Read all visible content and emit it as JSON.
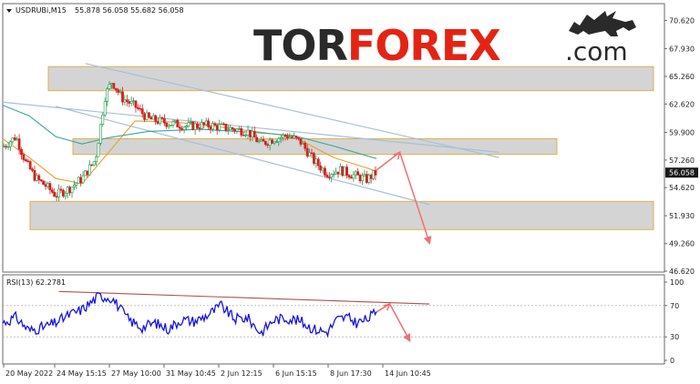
{
  "chart_data": [
    {
      "type": "candlestick",
      "symbol_label": "USDRUBi,M15",
      "ohlc_label": "55.878 56.058 55.682 56.058",
      "current_price": 56.058,
      "current_price_label": "56.058",
      "y_ticks": [
        "70.620",
        "67.930",
        "65.260",
        "62.620",
        "59.900",
        "57.260",
        "54.620",
        "51.930",
        "49.260",
        "46.620"
      ],
      "ylim": [
        46.62,
        70.62
      ],
      "x_ticks": [
        "20 May 2022",
        "24 May 15:15",
        "27 May 10:00",
        "31 May 10:45",
        "2 Jun 12:15",
        "6 Jun 15:15",
        "8 Jun 17:30",
        "14 Jun 10:45"
      ],
      "zones": [
        {
          "from": 63.9,
          "to": 66.2
        },
        {
          "from": 57.8,
          "to": 59.3
        },
        {
          "from": 50.6,
          "to": 53.3
        }
      ],
      "channel": {
        "upper": [
          {
            "t": 0.125,
            "p": 66.5
          },
          {
            "t": 0.75,
            "p": 57.5
          }
        ],
        "middle": [
          {
            "t": 0.0,
            "p": 62.8
          },
          {
            "t": 0.75,
            "p": 58.0
          }
        ],
        "lower": [
          {
            "t": 0.08,
            "p": 62.4
          },
          {
            "t": 0.645,
            "p": 53.0
          }
        ]
      },
      "forecast": [
        {
          "t": 0.565,
          "p": 56.3
        },
        {
          "t": 0.6,
          "p": 58.0
        },
        {
          "t": 0.645,
          "p": 49.3
        }
      ],
      "price_path": [
        {
          "t": 0.0,
          "p": 58.5
        },
        {
          "t": 0.02,
          "p": 59.5
        },
        {
          "t": 0.035,
          "p": 57.0
        },
        {
          "t": 0.05,
          "p": 55.5
        },
        {
          "t": 0.065,
          "p": 54.8
        },
        {
          "t": 0.08,
          "p": 53.9
        },
        {
          "t": 0.1,
          "p": 54.5
        },
        {
          "t": 0.12,
          "p": 55.5
        },
        {
          "t": 0.14,
          "p": 57.3
        },
        {
          "t": 0.155,
          "p": 63.5
        },
        {
          "t": 0.165,
          "p": 64.8
        },
        {
          "t": 0.18,
          "p": 63.2
        },
        {
          "t": 0.2,
          "p": 62.4
        },
        {
          "t": 0.22,
          "p": 61.2
        },
        {
          "t": 0.25,
          "p": 60.8
        },
        {
          "t": 0.28,
          "p": 60.5
        },
        {
          "t": 0.31,
          "p": 60.6
        },
        {
          "t": 0.34,
          "p": 60.3
        },
        {
          "t": 0.37,
          "p": 60.0
        },
        {
          "t": 0.39,
          "p": 58.8
        },
        {
          "t": 0.41,
          "p": 59.3
        },
        {
          "t": 0.43,
          "p": 59.6
        },
        {
          "t": 0.45,
          "p": 59.0
        },
        {
          "t": 0.47,
          "p": 57.2
        },
        {
          "t": 0.49,
          "p": 56.0
        },
        {
          "t": 0.51,
          "p": 56.3
        },
        {
          "t": 0.53,
          "p": 55.8
        },
        {
          "t": 0.55,
          "p": 55.4
        },
        {
          "t": 0.565,
          "p": 56.058
        }
      ],
      "moving_averages": [
        {
          "color": "#e8a030",
          "points": [
            {
              "t": 0.0,
              "p": 59.3
            },
            {
              "t": 0.04,
              "p": 57.5
            },
            {
              "t": 0.08,
              "p": 55.5
            },
            {
              "t": 0.12,
              "p": 55.0
            },
            {
              "t": 0.16,
              "p": 58.0
            },
            {
              "t": 0.2,
              "p": 61.0
            },
            {
              "t": 0.26,
              "p": 60.9
            },
            {
              "t": 0.32,
              "p": 60.5
            },
            {
              "t": 0.38,
              "p": 60.0
            },
            {
              "t": 0.44,
              "p": 59.5
            },
            {
              "t": 0.5,
              "p": 57.5
            },
            {
              "t": 0.565,
              "p": 56.2
            }
          ]
        },
        {
          "color": "#3aa69a",
          "points": [
            {
              "t": 0.0,
              "p": 62.5
            },
            {
              "t": 0.04,
              "p": 61.5
            },
            {
              "t": 0.08,
              "p": 59.5
            },
            {
              "t": 0.12,
              "p": 58.8
            },
            {
              "t": 0.16,
              "p": 59.4
            },
            {
              "t": 0.22,
              "p": 60.0
            },
            {
              "t": 0.3,
              "p": 60.2
            },
            {
              "t": 0.38,
              "p": 59.9
            },
            {
              "t": 0.44,
              "p": 59.6
            },
            {
              "t": 0.5,
              "p": 58.6
            },
            {
              "t": 0.565,
              "p": 57.4
            }
          ]
        }
      ],
      "colors": {
        "bull": "#1a9c4a",
        "bear": "#d62020",
        "zone_fill": "#d4d4d4",
        "zone_border": "#e0b050",
        "channel": "#a8c0d8",
        "forecast": "#f07070",
        "rsi": "#1414e6",
        "rsi_trend": "#b05050"
      }
    },
    {
      "type": "line",
      "indicator_label": "RSI(13) 62.2781",
      "y_ticks": [
        "100",
        "70",
        "30",
        "0"
      ],
      "ylim": [
        0,
        100
      ],
      "levels": [
        70,
        30
      ],
      "current_value": 62.2781,
      "trendline": [
        {
          "t": 0.085,
          "v": 88
        },
        {
          "t": 0.645,
          "v": 72
        }
      ],
      "forecast": [
        {
          "t": 0.565,
          "v": 62
        },
        {
          "t": 0.585,
          "v": 72
        },
        {
          "t": 0.615,
          "v": 25
        }
      ],
      "path": [
        {
          "t": 0.0,
          "v": 48
        },
        {
          "t": 0.02,
          "v": 55
        },
        {
          "t": 0.04,
          "v": 38
        },
        {
          "t": 0.06,
          "v": 42
        },
        {
          "t": 0.08,
          "v": 48
        },
        {
          "t": 0.1,
          "v": 58
        },
        {
          "t": 0.12,
          "v": 65
        },
        {
          "t": 0.145,
          "v": 82
        },
        {
          "t": 0.165,
          "v": 80
        },
        {
          "t": 0.19,
          "v": 52
        },
        {
          "t": 0.21,
          "v": 42
        },
        {
          "t": 0.23,
          "v": 48
        },
        {
          "t": 0.25,
          "v": 40
        },
        {
          "t": 0.27,
          "v": 52
        },
        {
          "t": 0.29,
          "v": 50
        },
        {
          "t": 0.31,
          "v": 58
        },
        {
          "t": 0.33,
          "v": 70
        },
        {
          "t": 0.35,
          "v": 53
        },
        {
          "t": 0.37,
          "v": 54
        },
        {
          "t": 0.39,
          "v": 35
        },
        {
          "t": 0.41,
          "v": 52
        },
        {
          "t": 0.43,
          "v": 54
        },
        {
          "t": 0.45,
          "v": 50
        },
        {
          "t": 0.47,
          "v": 40
        },
        {
          "t": 0.49,
          "v": 36
        },
        {
          "t": 0.505,
          "v": 52
        },
        {
          "t": 0.52,
          "v": 55
        },
        {
          "t": 0.535,
          "v": 48
        },
        {
          "t": 0.55,
          "v": 52
        },
        {
          "t": 0.565,
          "v": 62.28
        }
      ]
    }
  ],
  "watermark": {
    "part1": "TOR",
    "part2": "FOREX",
    "part3": ".com"
  },
  "colors": {
    "watermark_dark": "#2a2a2a",
    "watermark_red": "#e32415",
    "axis": "#6a6a6a",
    "grid": "#d6d6d6"
  }
}
